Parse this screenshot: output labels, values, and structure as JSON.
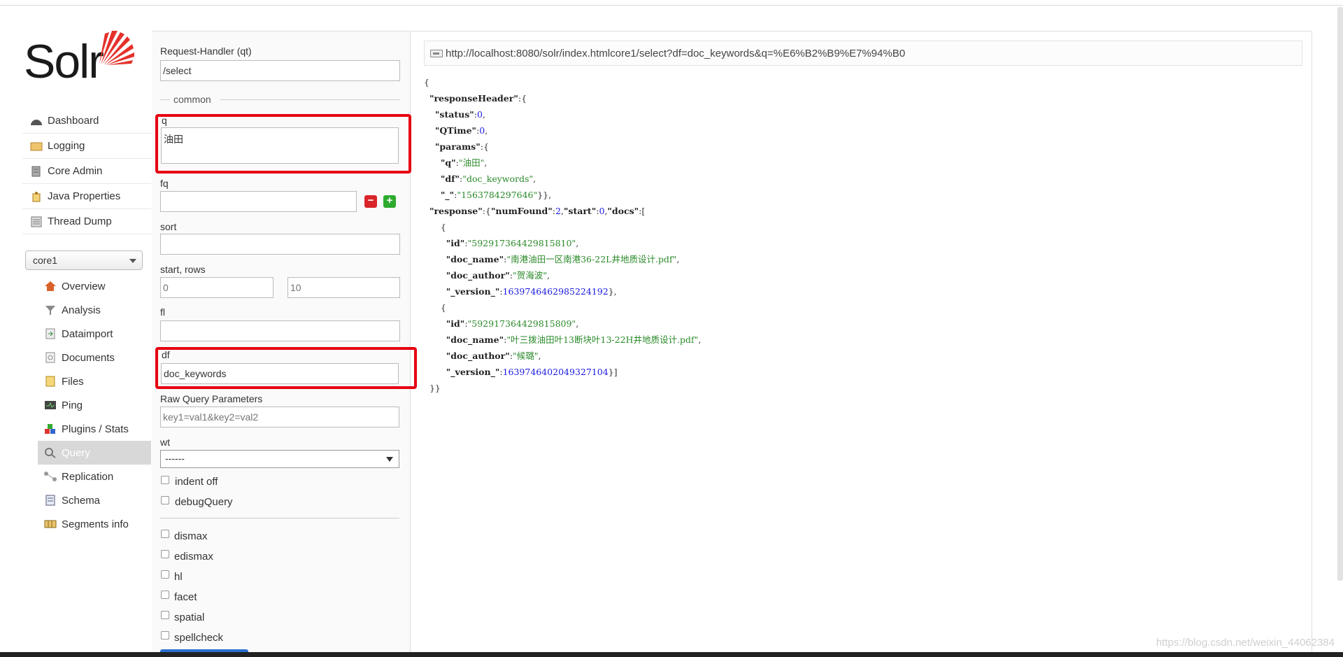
{
  "logo": {
    "text": "Solr"
  },
  "nav": {
    "items": [
      {
        "label": "Dashboard",
        "icon": "dashboard-icon"
      },
      {
        "label": "Logging",
        "icon": "logging-icon"
      },
      {
        "label": "Core Admin",
        "icon": "core-admin-icon"
      },
      {
        "label": "Java Properties",
        "icon": "java-properties-icon"
      },
      {
        "label": "Thread Dump",
        "icon": "thread-dump-icon"
      }
    ],
    "core_selector": "core1",
    "core_items": [
      {
        "label": "Overview"
      },
      {
        "label": "Analysis"
      },
      {
        "label": "Dataimport"
      },
      {
        "label": "Documents"
      },
      {
        "label": "Files"
      },
      {
        "label": "Ping"
      },
      {
        "label": "Plugins / Stats"
      },
      {
        "label": "Query"
      },
      {
        "label": "Replication"
      },
      {
        "label": "Schema"
      },
      {
        "label": "Segments info"
      }
    ]
  },
  "form": {
    "handler_label": "Request-Handler (qt)",
    "handler_value": "/select",
    "common_legend": "common",
    "q_label": "q",
    "q_value": "油田",
    "fq_label": "fq",
    "fq_value": "",
    "sort_label": "sort",
    "sort_value": "",
    "start_rows_label": "start, rows",
    "start_placeholder": "0",
    "rows_placeholder": "10",
    "fl_label": "fl",
    "fl_value": "",
    "df_label": "df",
    "df_value": "doc_keywords",
    "raw_label": "Raw Query Parameters",
    "raw_placeholder": "key1=val1&key2=val2",
    "wt_label": "wt",
    "wt_value": "------",
    "checks": [
      "indent off",
      "debugQuery"
    ],
    "checks2": [
      "dismax",
      "edismax",
      "hl",
      "facet",
      "spatial",
      "spellcheck"
    ]
  },
  "result": {
    "url": "http://localhost:8080/solr/index.htmlcore1/select?df=doc_keywords&q=%E6%B2%B9%E7%94%B0",
    "json_lines": [
      [
        {
          "t": "{",
          "c": "p"
        }
      ],
      [
        {
          "t": "  ",
          "c": "p"
        },
        {
          "t": "\"responseHeader\"",
          "c": "k"
        },
        {
          "t": ":{",
          "c": "p"
        }
      ],
      [
        {
          "t": "    ",
          "c": "p"
        },
        {
          "t": "\"status\"",
          "c": "k"
        },
        {
          "t": ":",
          "c": "p"
        },
        {
          "t": "0",
          "c": "n"
        },
        {
          "t": ",",
          "c": "p"
        }
      ],
      [
        {
          "t": "    ",
          "c": "p"
        },
        {
          "t": "\"QTime\"",
          "c": "k"
        },
        {
          "t": ":",
          "c": "p"
        },
        {
          "t": "0",
          "c": "n"
        },
        {
          "t": ",",
          "c": "p"
        }
      ],
      [
        {
          "t": "    ",
          "c": "p"
        },
        {
          "t": "\"params\"",
          "c": "k"
        },
        {
          "t": ":{",
          "c": "p"
        }
      ],
      [
        {
          "t": "      ",
          "c": "p"
        },
        {
          "t": "\"q\"",
          "c": "k"
        },
        {
          "t": ":",
          "c": "p"
        },
        {
          "t": "\"油田\"",
          "c": "s"
        },
        {
          "t": ",",
          "c": "p"
        }
      ],
      [
        {
          "t": "      ",
          "c": "p"
        },
        {
          "t": "\"df\"",
          "c": "k"
        },
        {
          "t": ":",
          "c": "p"
        },
        {
          "t": "\"doc_keywords\"",
          "c": "s"
        },
        {
          "t": ",",
          "c": "p"
        }
      ],
      [
        {
          "t": "      ",
          "c": "p"
        },
        {
          "t": "\"_\"",
          "c": "k"
        },
        {
          "t": ":",
          "c": "p"
        },
        {
          "t": "\"1563784297646\"",
          "c": "s"
        },
        {
          "t": "}},",
          "c": "p"
        }
      ],
      [
        {
          "t": "  ",
          "c": "p"
        },
        {
          "t": "\"response\"",
          "c": "k"
        },
        {
          "t": ":{",
          "c": "p"
        },
        {
          "t": "\"numFound\"",
          "c": "k"
        },
        {
          "t": ":",
          "c": "p"
        },
        {
          "t": "2",
          "c": "n"
        },
        {
          "t": ",",
          "c": "p"
        },
        {
          "t": "\"start\"",
          "c": "k"
        },
        {
          "t": ":",
          "c": "p"
        },
        {
          "t": "0",
          "c": "n"
        },
        {
          "t": ",",
          "c": "p"
        },
        {
          "t": "\"docs\"",
          "c": "k"
        },
        {
          "t": ":[",
          "c": "p"
        }
      ],
      [
        {
          "t": "      {",
          "c": "p"
        }
      ],
      [
        {
          "t": "        ",
          "c": "p"
        },
        {
          "t": "\"id\"",
          "c": "k"
        },
        {
          "t": ":",
          "c": "p"
        },
        {
          "t": "\"592917364429815810\"",
          "c": "s"
        },
        {
          "t": ",",
          "c": "p"
        }
      ],
      [
        {
          "t": "        ",
          "c": "p"
        },
        {
          "t": "\"doc_name\"",
          "c": "k"
        },
        {
          "t": ":",
          "c": "p"
        },
        {
          "t": "\"南港油田一区南港36-22L井地质设计.pdf\"",
          "c": "s"
        },
        {
          "t": ",",
          "c": "p"
        }
      ],
      [
        {
          "t": "        ",
          "c": "p"
        },
        {
          "t": "\"doc_author\"",
          "c": "k"
        },
        {
          "t": ":",
          "c": "p"
        },
        {
          "t": "\"贺海波\"",
          "c": "s"
        },
        {
          "t": ",",
          "c": "p"
        }
      ],
      [
        {
          "t": "        ",
          "c": "p"
        },
        {
          "t": "\"_version_\"",
          "c": "k"
        },
        {
          "t": ":",
          "c": "p"
        },
        {
          "t": "1639746462985224192",
          "c": "n"
        },
        {
          "t": "},",
          "c": "p"
        }
      ],
      [
        {
          "t": "      {",
          "c": "p"
        }
      ],
      [
        {
          "t": "        ",
          "c": "p"
        },
        {
          "t": "\"id\"",
          "c": "k"
        },
        {
          "t": ":",
          "c": "p"
        },
        {
          "t": "\"592917364429815809\"",
          "c": "s"
        },
        {
          "t": ",",
          "c": "p"
        }
      ],
      [
        {
          "t": "        ",
          "c": "p"
        },
        {
          "t": "\"doc_name\"",
          "c": "k"
        },
        {
          "t": ":",
          "c": "p"
        },
        {
          "t": "\"叶三拨油田叶13断块叶13-22H井地质设计.pdf\"",
          "c": "s"
        },
        {
          "t": ",",
          "c": "p"
        }
      ],
      [
        {
          "t": "        ",
          "c": "p"
        },
        {
          "t": "\"doc_author\"",
          "c": "k"
        },
        {
          "t": ":",
          "c": "p"
        },
        {
          "t": "\"候璐\"",
          "c": "s"
        },
        {
          "t": ",",
          "c": "p"
        }
      ],
      [
        {
          "t": "        ",
          "c": "p"
        },
        {
          "t": "\"_version_\"",
          "c": "k"
        },
        {
          "t": ":",
          "c": "p"
        },
        {
          "t": "1639746402049327104",
          "c": "n"
        },
        {
          "t": "}]",
          "c": "p"
        }
      ],
      [
        {
          "t": "  }}",
          "c": "p"
        }
      ]
    ]
  },
  "watermark": "https://blog.csdn.net/weixin_44062384",
  "colors": {
    "highlight": "#e60012",
    "active_nav": "#d8d8d8",
    "string": "#2a8a2a",
    "number": "#1a1ae0"
  }
}
